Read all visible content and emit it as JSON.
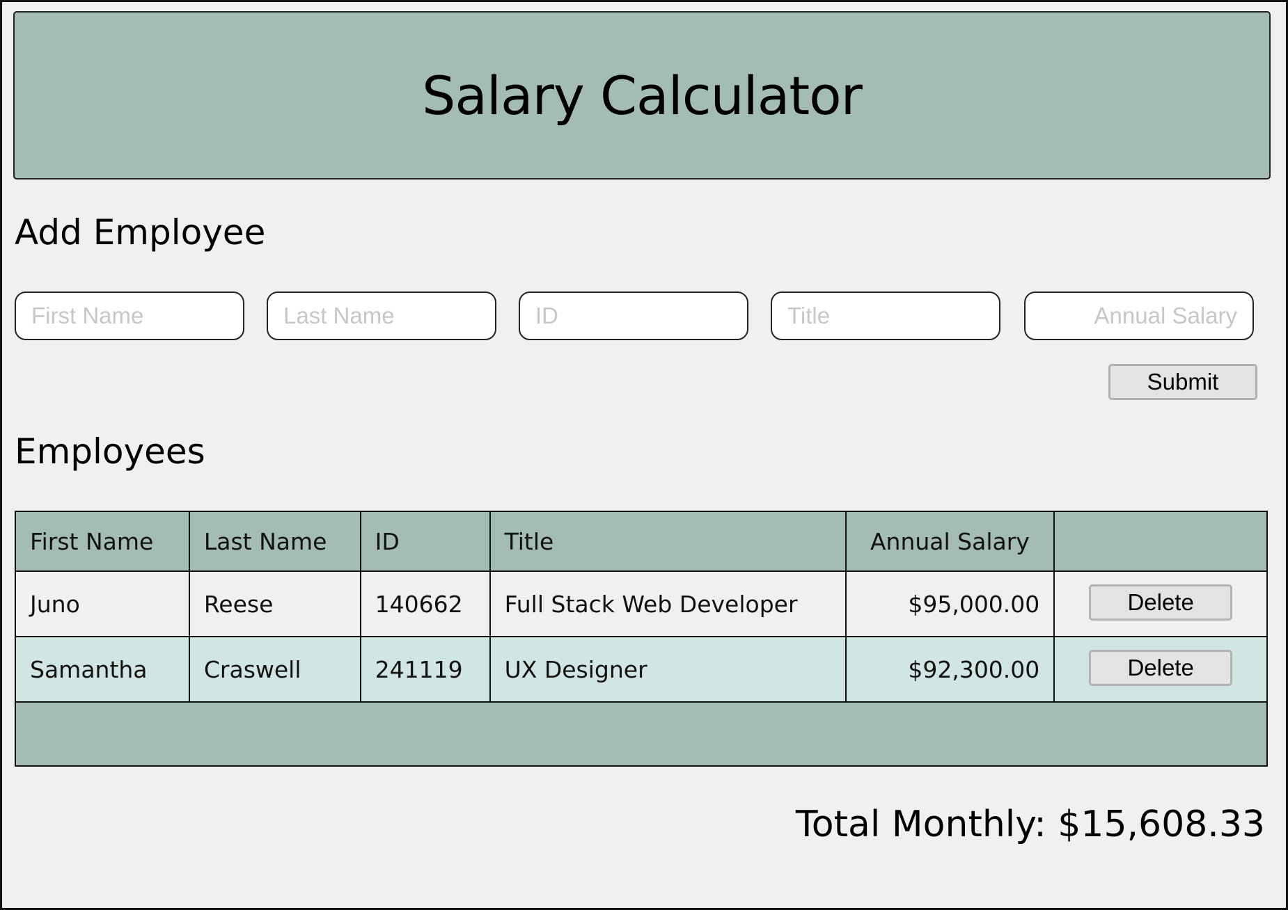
{
  "header": {
    "title": "Salary Calculator"
  },
  "add_employee": {
    "title": "Add Employee",
    "fields": {
      "first_name": {
        "placeholder": "First Name",
        "value": ""
      },
      "last_name": {
        "placeholder": "Last Name",
        "value": ""
      },
      "id": {
        "placeholder": "ID",
        "value": ""
      },
      "title": {
        "placeholder": "Title",
        "value": ""
      },
      "annual_salary": {
        "placeholder": "Annual Salary",
        "value": ""
      }
    },
    "submit_label": "Submit"
  },
  "employees": {
    "title": "Employees",
    "columns": [
      "First Name",
      "Last Name",
      "ID",
      "Title",
      "Annual Salary",
      ""
    ],
    "rows": [
      {
        "first_name": "Juno",
        "last_name": "Reese",
        "id": "140662",
        "title": "Full Stack Web Developer",
        "annual_salary": "$95,000.00",
        "delete_label": "Delete"
      },
      {
        "first_name": "Samantha",
        "last_name": "Craswell",
        "id": "241119",
        "title": "UX Designer",
        "annual_salary": "$92,300.00",
        "delete_label": "Delete"
      }
    ]
  },
  "total_monthly": "Total Monthly: $15,608.33",
  "colors": {
    "header_bg": "#a3bcb5",
    "page_bg": "#f0f0ef",
    "row_alt_bg": "#d1e6e3"
  }
}
